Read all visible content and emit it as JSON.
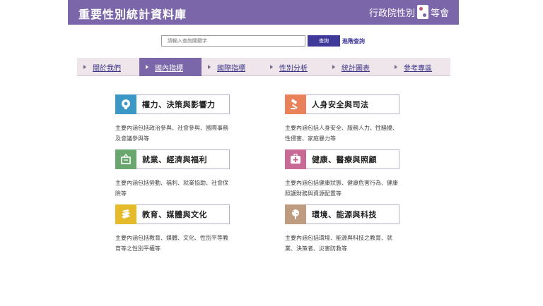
{
  "header": {
    "title": "重要性別統計資料庫",
    "org_left": "行政院性別",
    "org_right": "等會"
  },
  "search": {
    "placeholder": "請輸入查詢關鍵字",
    "button_label": "查詢",
    "advanced_label": "進階查詢"
  },
  "nav": {
    "items": [
      {
        "label": "關於我們"
      },
      {
        "label": "國內指標"
      },
      {
        "label": "國際指標"
      },
      {
        "label": "性別分析"
      },
      {
        "label": "統計圖表"
      },
      {
        "label": "參考專區"
      }
    ]
  },
  "categories": [
    {
      "title": "權力、決策與影響力",
      "desc": "主要內涵包括政治參與、社會參與、國際事務及會議參與等",
      "color": "#3a97c6",
      "icon": "lightbulb-head-icon"
    },
    {
      "title": "人身安全與司法",
      "desc": "主要內涵包括人身安全、服務人力、性騷擾、性侵害、家庭暴力等",
      "color": "#e9825a",
      "icon": "gavel-icon"
    },
    {
      "title": "就業、經濟與福利",
      "desc": "主要內涵包括勞動、福利、就業協助、社會保險等",
      "color": "#6aa76f",
      "icon": "basket-icon"
    },
    {
      "title": "健康、醫療與照顧",
      "desc": "主要內涵包括健康狀態、健康危害行為、健康照護財務與資源配置等",
      "color": "#c86a95",
      "icon": "medical-kit-icon"
    },
    {
      "title": "教育、媒體與文化",
      "desc": "主要內涵包括教育、媒體、文化、性別平等教育等之性別平權等",
      "color": "#e5bb2c",
      "icon": "books-icon"
    },
    {
      "title": "環境、能源與科技",
      "desc": "主要內涵包括環境、能源與科技之教育、就業、決策者、災害防救等",
      "color": "#bf9c7f",
      "icon": "tree-icon"
    }
  ]
}
